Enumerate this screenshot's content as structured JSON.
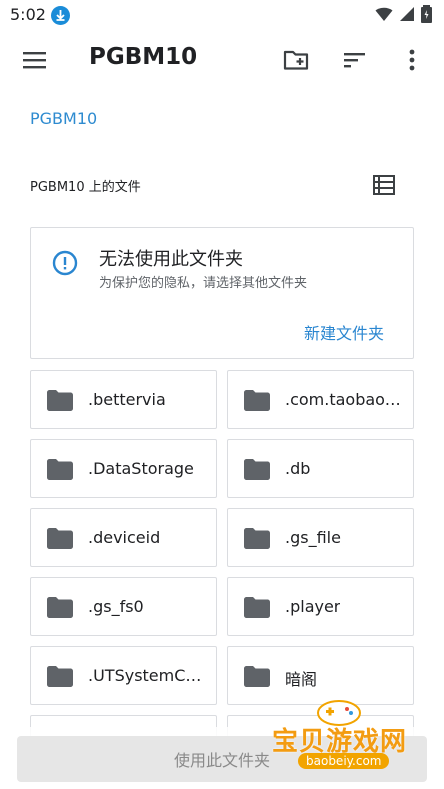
{
  "status_bar": {
    "time": "5:02"
  },
  "app_bar": {
    "title": "PGBM10"
  },
  "breadcrumb": {
    "label": "PGBM10"
  },
  "files_header": {
    "label": "PGBM10 上的文件"
  },
  "warning_card": {
    "title": "无法使用此文件夹",
    "subtitle": "为保护您的隐私，请选择其他文件夹",
    "new_folder_label": "新建文件夹"
  },
  "folders": [
    {
      "name": ".bettervia"
    },
    {
      "name": ".com.taobao.…"
    },
    {
      "name": ".DataStorage"
    },
    {
      "name": ".db"
    },
    {
      "name": ".deviceid"
    },
    {
      "name": ".gs_file"
    },
    {
      "name": ".gs_fs0"
    },
    {
      "name": ".player"
    },
    {
      "name": ".UTSystemC…"
    },
    {
      "name": "暗阁"
    }
  ],
  "bottom": {
    "use_folder_label": "使用此文件夹"
  },
  "watermark": {
    "text": "宝贝游戏网",
    "url": "baobeiy.com"
  },
  "colors": {
    "accent": "#2a86d0",
    "icon": "#5f6368",
    "border": "#dadce0"
  }
}
